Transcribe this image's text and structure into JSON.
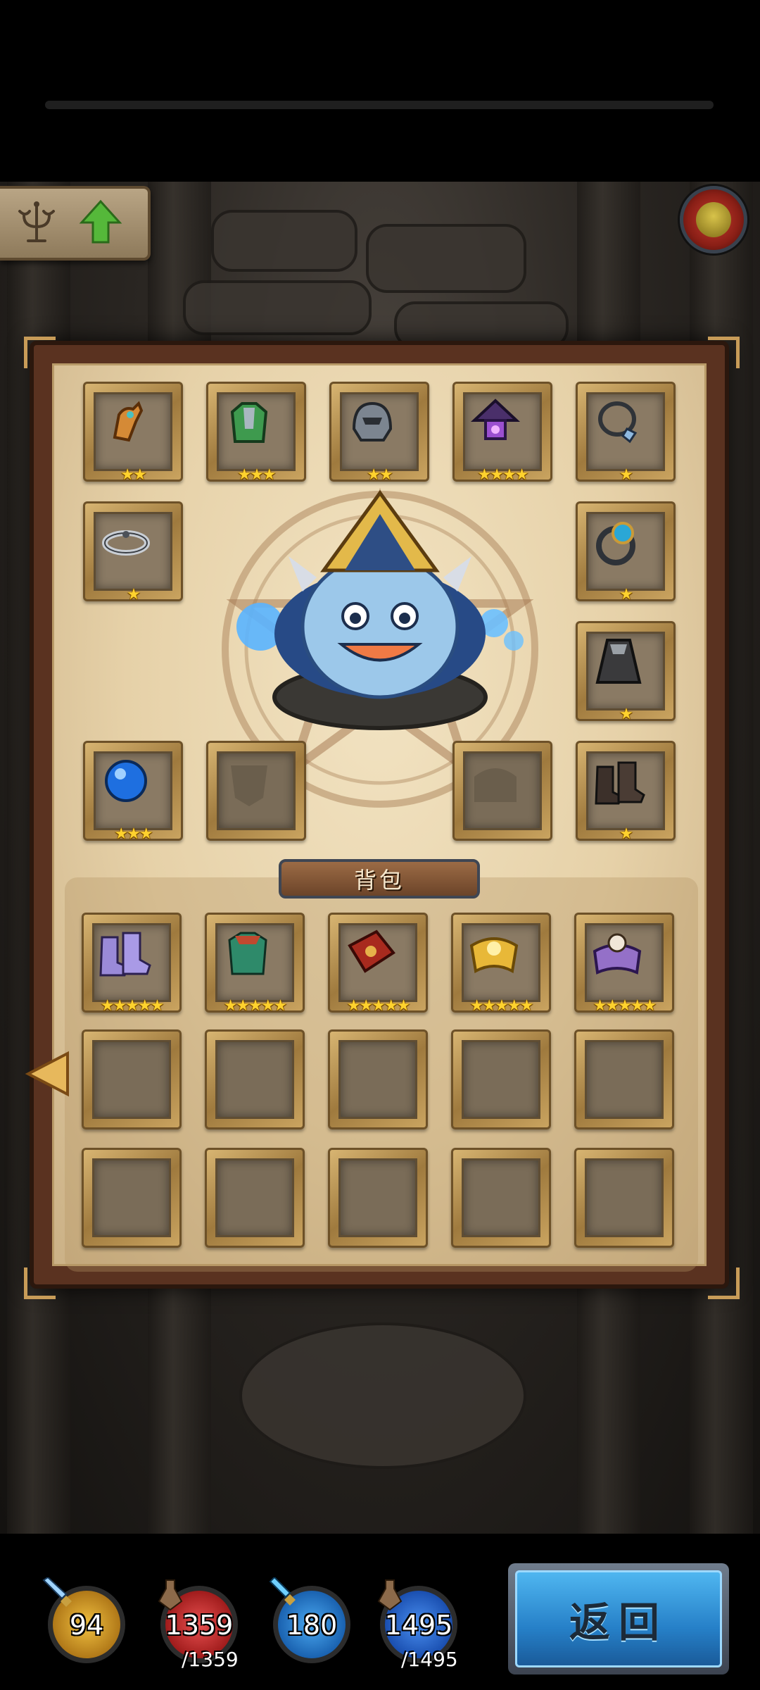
{
  "equipment": {
    "slots": [
      {
        "icon": "gauntlet-icon",
        "stars": "★★"
      },
      {
        "icon": "green-armor-icon",
        "stars": "★★★"
      },
      {
        "icon": "iron-helmet-icon",
        "stars": "★★"
      },
      {
        "icon": "purple-lantern-icon",
        "stars": "★★★★"
      },
      {
        "icon": "silver-necklace-icon",
        "stars": "★"
      },
      {
        "icon": "silver-bracelet-icon",
        "stars": "★"
      },
      {
        "icon": "sapphire-ring-icon",
        "stars": "★"
      },
      {
        "icon": "dark-cape-icon",
        "stars": "★"
      },
      {
        "icon": "blue-orb-icon",
        "stars": "★★★"
      },
      {
        "icon": "empty-mask-slot-icon",
        "stars": ""
      },
      {
        "icon": "empty-chest-slot-icon",
        "stars": ""
      },
      {
        "icon": "leather-boots-icon",
        "stars": "★"
      }
    ]
  },
  "bag": {
    "title": "背包",
    "items": [
      {
        "icon": "purple-boots-icon",
        "stars": "★★★★★"
      },
      {
        "icon": "green-robe-icon",
        "stars": "★★★★★"
      },
      {
        "icon": "red-tome-icon",
        "stars": "★★★★★"
      },
      {
        "icon": "golden-scroll-icon",
        "stars": "★★★★★"
      },
      {
        "icon": "skull-spellbook-icon",
        "stars": "★★★★★"
      }
    ],
    "empty_slots": 10
  },
  "stats": {
    "attack": {
      "value": "94"
    },
    "hp": {
      "value": "1359",
      "max": "/1359"
    },
    "defense": {
      "value": "180"
    },
    "mana": {
      "value": "1495",
      "max": "/1495"
    }
  },
  "back_button": {
    "label": "返回"
  },
  "colors": {
    "panel_parchment": "#e6d1a8",
    "panel_border": "#5a3220",
    "star": "#ffd22e",
    "back_button": "#2680c8"
  }
}
